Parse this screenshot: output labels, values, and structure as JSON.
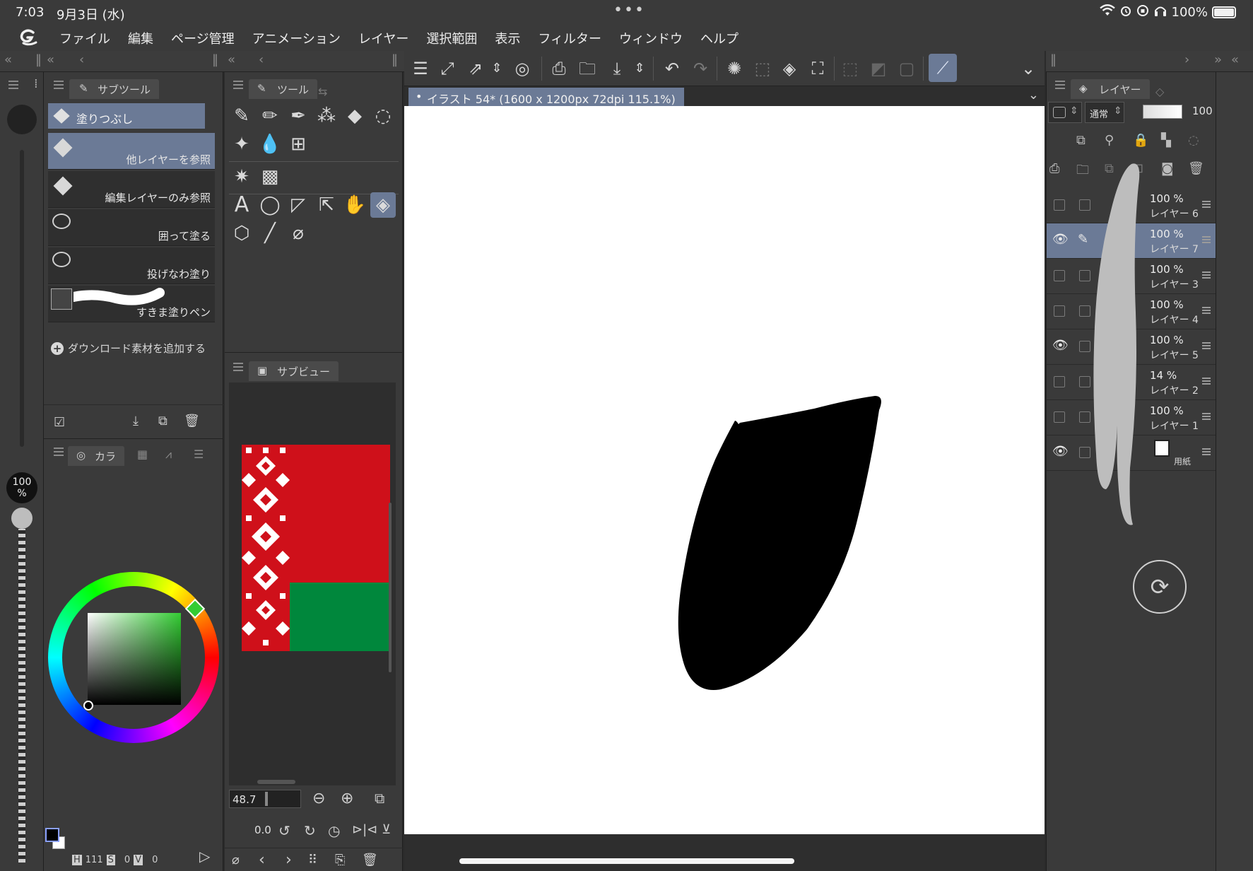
{
  "status_bar": {
    "time": "7:03",
    "date": "9月3日 (水)",
    "battery": "100%",
    "more": "•••"
  },
  "menubar": {
    "logo_icon": "clip-studio-logo",
    "items": [
      "ファイル",
      "編集",
      "ページ管理",
      "アニメーション",
      "レイヤー",
      "選択範囲",
      "表示",
      "フィルター",
      "ウィンドウ",
      "ヘルプ"
    ]
  },
  "subtool_panel": {
    "tab_label": "サブツール",
    "group_label": "塗りつぶし",
    "items": [
      {
        "label": "他レイヤーを参照",
        "selected": true
      },
      {
        "label": "編集レイヤーのみ参照",
        "selected": false
      },
      {
        "label": "囲って塗る",
        "selected": false
      },
      {
        "label": "投げなわ塗り",
        "selected": false
      },
      {
        "label": "すきま塗りペン",
        "selected": false
      }
    ],
    "add_material": "ダウンロード素材を追加する"
  },
  "brush_size": {
    "value": "100",
    "unit": "%"
  },
  "color_panel": {
    "tab_label": "カラ",
    "h_label": "H",
    "h_value": "111",
    "s_label": "S",
    "s_value": "0",
    "v_label": "V",
    "v_value": "0",
    "hue_color": "#33cc33"
  },
  "tool_panel": {
    "tab_label": "ツール"
  },
  "subview_panel": {
    "tab_label": "サブビュー",
    "zoom_value": "48.7",
    "rotate_value": "0.0",
    "flag_colors": {
      "red": "#cf101a",
      "green": "#00873c",
      "white": "#ffffff"
    }
  },
  "canvas": {
    "tab_label": "イラスト 54* (1600 x 1200px 72dpi 115.1%)"
  },
  "layer_panel": {
    "tab_label": "レイヤー",
    "blend_mode": "通常",
    "opacity": "100",
    "layers": [
      {
        "pct": "100 %",
        "name": "レイヤー 6",
        "visible": false,
        "selected": false
      },
      {
        "pct": "100 %",
        "name": "レイヤー 7",
        "visible": true,
        "selected": true
      },
      {
        "pct": "100 %",
        "name": "レイヤー 3",
        "visible": false,
        "selected": false
      },
      {
        "pct": "100 %",
        "name": "レイヤー 4",
        "visible": false,
        "selected": false
      },
      {
        "pct": "100 %",
        "name": "レイヤー 5",
        "visible": true,
        "selected": false
      },
      {
        "pct": "14 %",
        "name": "レイヤー 2",
        "visible": false,
        "selected": false
      },
      {
        "pct": "100 %",
        "name": "レイヤー 1",
        "visible": false,
        "selected": false
      },
      {
        "pct": "",
        "name": "用紙",
        "visible": true,
        "selected": false
      }
    ]
  },
  "colors": {
    "accent": "#6b7a96",
    "panel": "#3a3a3a",
    "background": "#2b2b2b"
  }
}
